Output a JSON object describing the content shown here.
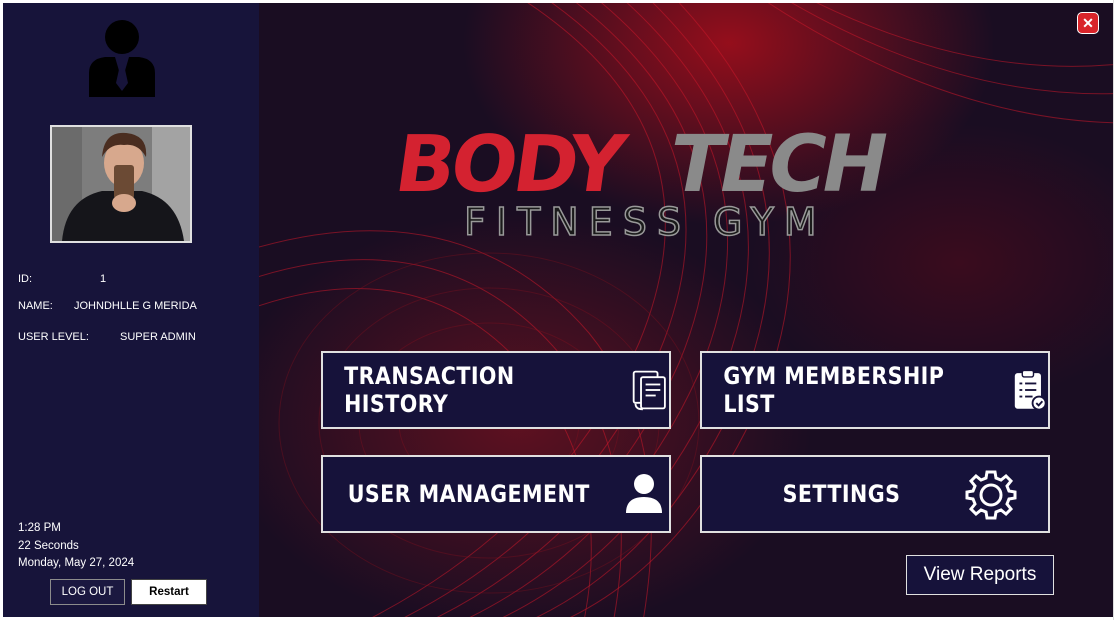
{
  "user": {
    "id_label": "ID:",
    "id_value": "1",
    "name_label": "NAME:",
    "name_value": "JOHNDHLLE G MERIDA",
    "level_label": "USER LEVEL:",
    "level_value": "SUPER ADMIN"
  },
  "clock": {
    "time": "1:28 PM",
    "seconds": "22 Seconds",
    "date": "Monday, May 27, 2024"
  },
  "sidebar_buttons": {
    "logout": "LOG OUT",
    "restart": "Restart"
  },
  "logo": {
    "word1": "BODY",
    "word2": "TECH",
    "subtitle": "FITNESS GYM"
  },
  "menu": {
    "transaction_history": "TRANSACTION HISTORY",
    "membership_list": "GYM MEMBERSHIP LIST",
    "user_management": "USER MANAGEMENT",
    "settings": "SETTINGS",
    "view_reports": "View Reports"
  },
  "icons": {
    "close": "close-icon",
    "user_avatar": "businessman-icon",
    "transaction": "document-transfer-icon",
    "membership": "clipboard-check-icon",
    "user_management": "person-icon",
    "settings": "gear-icon"
  },
  "colors": {
    "sidebar_bg": "#17143a",
    "button_bg": "#16123a",
    "brand_red": "#d42230",
    "brand_gray": "#8a8a8a",
    "close_red": "#d9242a"
  }
}
